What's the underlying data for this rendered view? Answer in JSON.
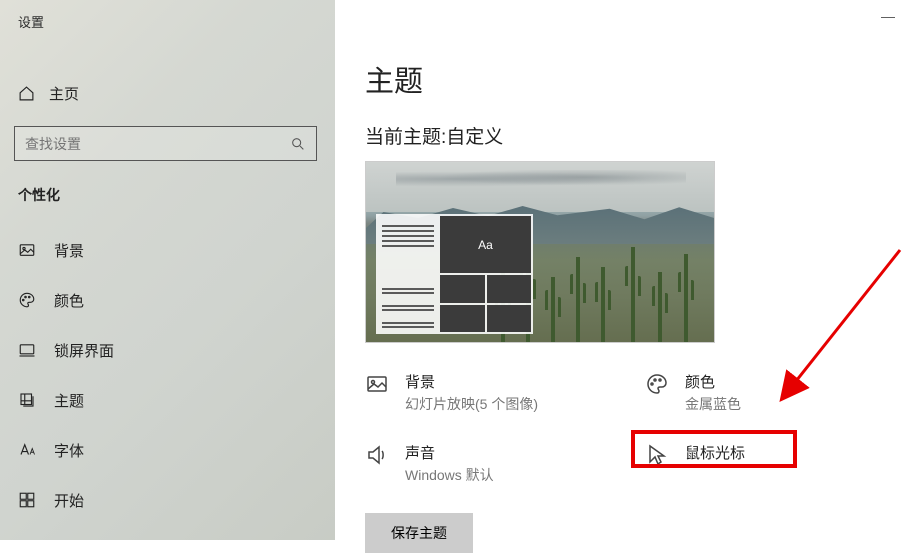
{
  "app_title": "设置",
  "home_label": "主页",
  "search": {
    "placeholder": "查找设置"
  },
  "section_label": "个性化",
  "nav": [
    {
      "key": "background",
      "label": "背景"
    },
    {
      "key": "colors",
      "label": "颜色"
    },
    {
      "key": "lockscreen",
      "label": "锁屏界面"
    },
    {
      "key": "themes",
      "label": "主题"
    },
    {
      "key": "fonts",
      "label": "字体"
    },
    {
      "key": "start",
      "label": "开始"
    }
  ],
  "page_title": "主题",
  "subtitle": "当前主题:自定义",
  "preview_tile_text": "Aa",
  "options": {
    "background": {
      "label": "背景",
      "sub": "幻灯片放映(5 个图像)"
    },
    "colors": {
      "label": "颜色",
      "sub": "金属蓝色"
    },
    "sounds": {
      "label": "声音",
      "sub": "Windows 默认"
    },
    "cursor": {
      "label": "鼠标光标"
    }
  },
  "save_button": "保存主题"
}
